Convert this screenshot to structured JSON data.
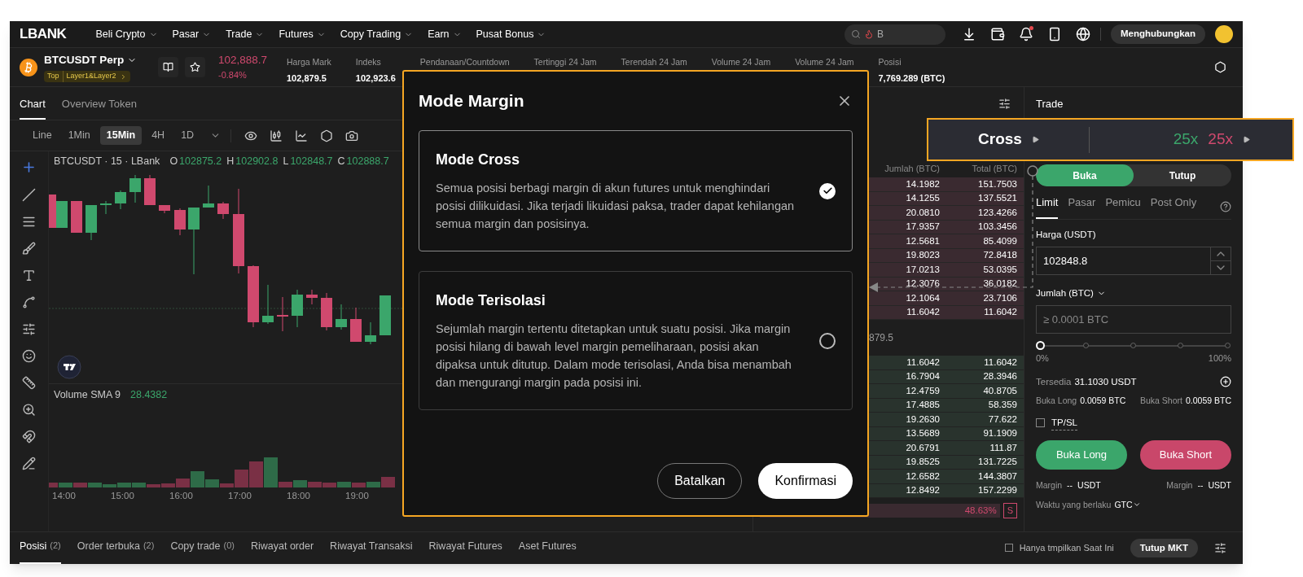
{
  "nav": {
    "logo": "LBANK",
    "menu": [
      {
        "label": "Beli Crypto"
      },
      {
        "label": "Pasar"
      },
      {
        "label": "Trade"
      },
      {
        "label": "Futures"
      },
      {
        "label": "Copy Trading"
      },
      {
        "label": "Earn"
      },
      {
        "label": "Pusat Bonus"
      }
    ],
    "search": {
      "value": "B"
    },
    "connect_button": "Menghubungkan"
  },
  "ticker": {
    "symbol": "BTCUSDT Perp",
    "tags": [
      "Top",
      "Layer1&Layer2"
    ],
    "price": "102,888.7",
    "change": "-0.84%",
    "stats": [
      {
        "label": "Harga Mark",
        "value": "102,879.5"
      },
      {
        "label": "Indeks",
        "value": "102,923.6"
      },
      {
        "label": "Pendanaan/Countdown"
      },
      {
        "label": "Tertinggi 24 Jam"
      },
      {
        "label": "Terendah 24 Jam"
      },
      {
        "label": "Volume 24 Jam"
      },
      {
        "label": "Volume 24 Jam"
      },
      {
        "label": "Posisi",
        "value": "7,769.289 (BTC)"
      }
    ]
  },
  "chart_tabs": [
    {
      "label": "Chart",
      "selected": true
    },
    {
      "label": "Overview Token",
      "selected": false
    }
  ],
  "intervals": [
    {
      "label": "Line",
      "selected": false
    },
    {
      "label": "1Min",
      "selected": false
    },
    {
      "label": "15Min",
      "selected": true
    },
    {
      "label": "4H",
      "selected": false
    },
    {
      "label": "1D",
      "selected": false
    }
  ],
  "chart": {
    "symbol": "BTCUSDT · 15 · LBank",
    "ohlc": [
      {
        "key": "O",
        "value": "102875.2"
      },
      {
        "key": "H",
        "value": "102902.8"
      },
      {
        "key": "L",
        "value": "102848.7"
      },
      {
        "key": "C",
        "value": "102888.7"
      }
    ],
    "volume_label": "Volume SMA 9",
    "volume_value": "28.4382",
    "time_labels": [
      "14:00",
      "15:00",
      "16:00",
      "17:00",
      "18:00",
      "19:00"
    ]
  },
  "order_book": {
    "columns": [
      "Jumlah (BTC)",
      "Total (BTC)"
    ],
    "asks": [
      [
        "14.1982",
        "151.7503"
      ],
      [
        "14.1255",
        "137.5521"
      ],
      [
        "20.0810",
        "123.4266"
      ],
      [
        "17.9357",
        "103.3456"
      ],
      [
        "12.5681",
        "85.4099"
      ],
      [
        "19.8023",
        "72.8418"
      ],
      [
        "17.0213",
        "53.0395"
      ],
      [
        "12.3076",
        "36.0182"
      ],
      [
        "12.1064",
        "23.7106"
      ],
      [
        "11.6042",
        "11.6042"
      ]
    ],
    "mid_price": "879.5",
    "bids": [
      [
        "11.6042",
        "11.6042"
      ],
      [
        "16.7904",
        "28.3946"
      ],
      [
        "12.4759",
        "40.8705"
      ],
      [
        "17.4885",
        "58.359"
      ],
      [
        "19.2630",
        "77.622"
      ],
      [
        "13.5689",
        "91.1909"
      ],
      [
        "20.6791",
        "111.87"
      ],
      [
        "19.8525",
        "131.7225"
      ],
      [
        "12.6582",
        "144.3807"
      ],
      [
        "12.8492",
        "157.2299"
      ]
    ],
    "ratio": "48.63%",
    "ratio_side": "S"
  },
  "trade": {
    "title": "Trade",
    "sides": [
      {
        "label": "Buka",
        "selected": true
      },
      {
        "label": "Tutup",
        "selected": false
      }
    ],
    "order_types": [
      {
        "label": "Limit",
        "selected": true
      },
      {
        "label": "Pasar",
        "selected": false
      },
      {
        "label": "Pemicu",
        "selected": false
      },
      {
        "label": "Post Only",
        "selected": false
      }
    ],
    "price_label": "Harga (USDT)",
    "price_value": "102848.8",
    "amount_label": "Jumlah (BTC)",
    "amount_placeholder": "≥ 0.0001 BTC",
    "slider": {
      "level": 0,
      "min_label": "0%",
      "max_label": "100%"
    },
    "available_label": "Tersedia",
    "available_value": "31.1030 USDT",
    "open_long": {
      "label": "Buka Long",
      "value": "0.0059 BTC"
    },
    "open_short": {
      "label": "Buka Short",
      "value": "0.0059 BTC"
    },
    "tpsl": {
      "label": "TP/SL",
      "checked": false
    },
    "long_button": "Buka Long",
    "short_button": "Buka Short",
    "margins": [
      {
        "label": "Margin",
        "value": "--",
        "unit": "USDT"
      },
      {
        "label": "Margin",
        "value": "--",
        "unit": "USDT"
      }
    ],
    "validity": {
      "label": "Waktu yang berlaku",
      "value": "GTC"
    }
  },
  "bottom": {
    "tabs": [
      {
        "label": "Posisi",
        "count": "(2)",
        "selected": true
      },
      {
        "label": "Order terbuka",
        "count": "(2)",
        "selected": false
      },
      {
        "label": "Copy trade",
        "count": "(0)",
        "selected": false
      },
      {
        "label": "Riwayat order",
        "selected": false
      },
      {
        "label": "Riwayat Transaksi",
        "selected": false
      },
      {
        "label": "Riwayat Futures",
        "selected": false
      },
      {
        "label": "Aset Futures",
        "selected": false
      }
    ],
    "only_current": {
      "label": "Hanya tmpilkan Saat Ini",
      "checked": false
    },
    "close_button": "Tutup MKT"
  },
  "modal": {
    "title": "Mode Margin",
    "options": [
      {
        "title": "Mode Cross",
        "description": "Semua posisi berbagi margin di akun futures untuk menghindari posisi dilikuidasi. Jika terjadi likuidasi paksa, trader dapat kehilangan semua margin dan posisinya.",
        "selected": true
      },
      {
        "title": "Mode Terisolasi",
        "description": "Sejumlah margin tertentu ditetapkan untuk suatu posisi. Jika margin posisi hilang di bawah level margin pemeliharaan, posisi akan dipaksa untuk ditutup. Dalam mode terisolasi, Anda bisa menambah dan mengurangi margin pada posisi ini.",
        "selected": false
      }
    ],
    "cancel_button": "Batalkan",
    "confirm_button": "Konfirmasi"
  },
  "callout": {
    "mode": "Cross",
    "leverage_long": "25x",
    "leverage_short": "25x"
  }
}
